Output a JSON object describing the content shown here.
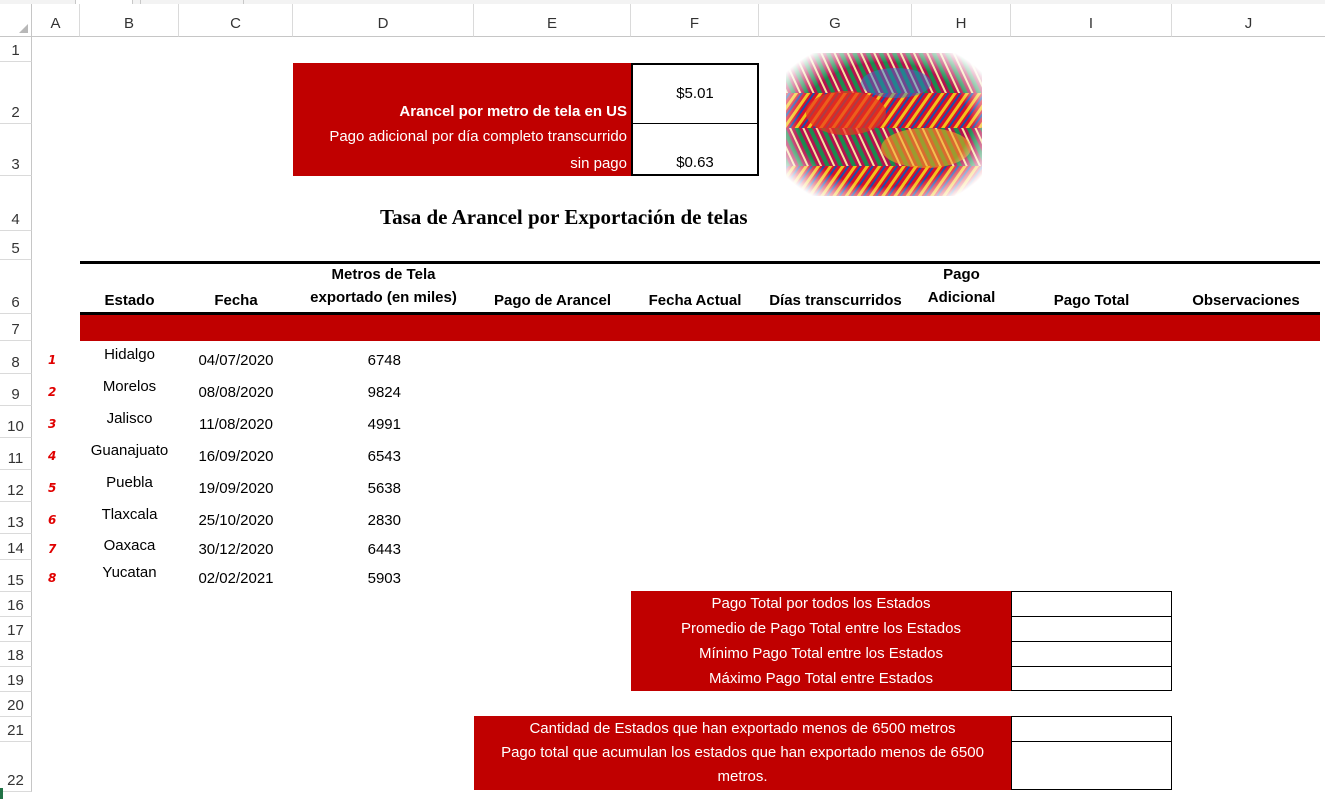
{
  "columns": [
    "A",
    "B",
    "C",
    "D",
    "E",
    "F",
    "G",
    "H",
    "I",
    "J"
  ],
  "rows": [
    "1",
    "2",
    "3",
    "4",
    "5",
    "6",
    "7",
    "8",
    "9",
    "10",
    "11",
    "12",
    "13",
    "14",
    "15",
    "16",
    "17",
    "18",
    "19",
    "20",
    "21",
    "22"
  ],
  "params": {
    "arancel_label": "Arancel por metro de tela  en US",
    "arancel_value": "$5.01",
    "pago_adicional_label_1": "Pago adicional por día completo transcurrido",
    "pago_adicional_label_2": "sin pago",
    "pago_adicional_value": "$0.63"
  },
  "title": "Tasa de Arancel por Exportación de telas",
  "headers": {
    "estado": "Estado",
    "fecha": "Fecha",
    "metros_1": "Metros de Tela",
    "metros_2": "exportado (en miles)",
    "pago_arancel": "Pago de Arancel",
    "fecha_actual": "Fecha Actual",
    "dias": "Días transcurridos",
    "pago_adicional_1": "Pago",
    "pago_adicional_2": "Adicional",
    "pago_total": "Pago Total",
    "observaciones": "Observaciones"
  },
  "data_rows": [
    {
      "n": "1",
      "estado": "Hidalgo",
      "fecha": "04/07/2020",
      "metros": "6748"
    },
    {
      "n": "2",
      "estado": "Morelos",
      "fecha": "08/08/2020",
      "metros": "9824"
    },
    {
      "n": "3",
      "estado": "Jalisco",
      "fecha": "11/08/2020",
      "metros": "4991"
    },
    {
      "n": "4",
      "estado": "Guanajuato",
      "fecha": "16/09/2020",
      "metros": "6543"
    },
    {
      "n": "5",
      "estado": "Puebla",
      "fecha": "19/09/2020",
      "metros": "5638"
    },
    {
      "n": "6",
      "estado": "Tlaxcala",
      "fecha": "25/10/2020",
      "metros": "2830"
    },
    {
      "n": "7",
      "estado": "Oaxaca",
      "fecha": "30/12/2020",
      "metros": "6443"
    },
    {
      "n": "8",
      "estado": "Yucatan",
      "fecha": "02/02/2021",
      "metros": "5903"
    }
  ],
  "summary": {
    "total": "Pago Total por todos los Estados",
    "promedio": "Promedio de Pago Total entre los Estados",
    "minimo": "Mínimo Pago Total entre los Estados",
    "maximo": "Máximo Pago Total  entre Estados",
    "cantidad": "Cantidad de Estados que han exportado menos de 6500 metros",
    "acumulado_1": "Pago total que acumulan los estados que han exportado menos de 6500",
    "acumulado_2": "metros."
  },
  "colors": {
    "accent_red": "#c00000",
    "index_red": "#e00000"
  },
  "image": {
    "icon": "colorful-fabric-rolls-image"
  }
}
